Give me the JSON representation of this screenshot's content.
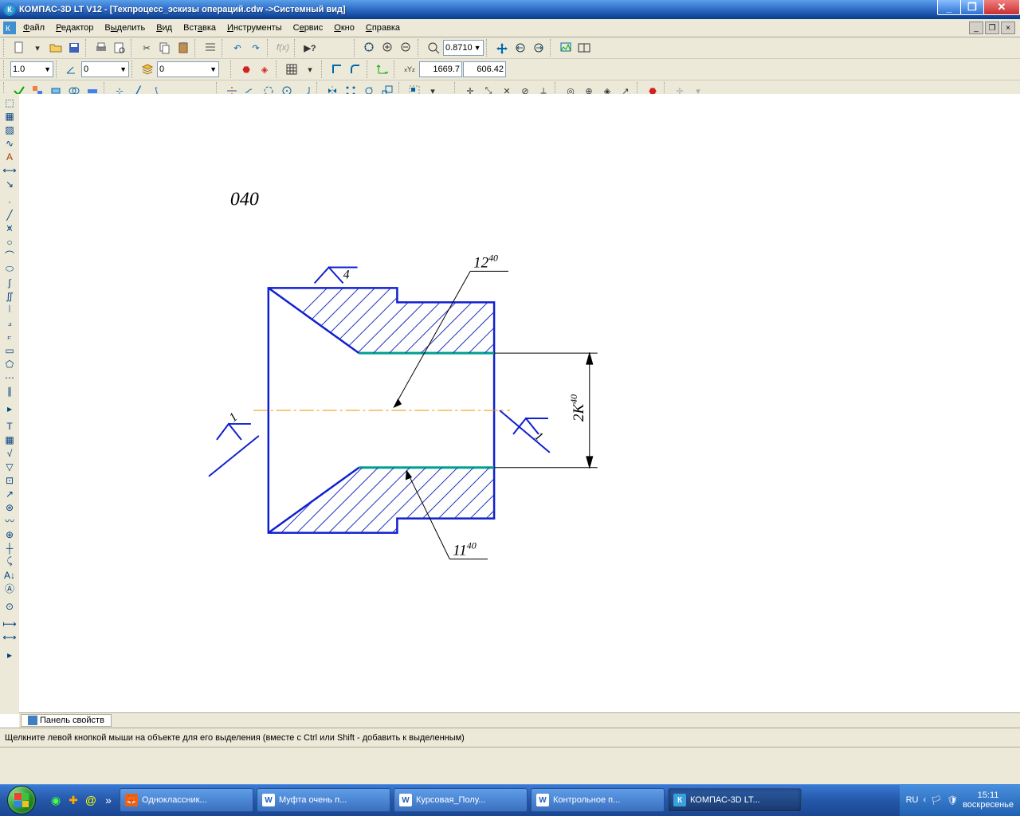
{
  "titlebar": {
    "app": "КОМПАС-3D LT V12",
    "doc": "[Техпроцесс_эскизы операций.cdw ->Системный вид]"
  },
  "menu": {
    "file": "Файл",
    "edit": "Редактор",
    "select": "Выделить",
    "view": "Вид",
    "insert": "Вставка",
    "tools": "Инструменты",
    "service": "Сервис",
    "window": "Окно",
    "help": "Справка"
  },
  "toolbar": {
    "zoom_val": "0.8710",
    "step": "1.0",
    "angle": "0",
    "layer": "0",
    "coord_x": "1669.7",
    "coord_y": "606.42"
  },
  "props": {
    "tab_label": "Панель свойств"
  },
  "status": {
    "hint": "Щелкните левой кнопкой мыши на объекте для его выделения (вместе с Ctrl или Shift - добавить к выделенным)"
  },
  "taskbar": {
    "items": [
      {
        "label": "Одноклассник..."
      },
      {
        "label": "Муфта очень п..."
      },
      {
        "label": "Курсовая_Полу..."
      },
      {
        "label": "Контрольное п..."
      },
      {
        "label": "КОМПАС-3D LT..."
      }
    ],
    "lang": "RU",
    "time": "15:11",
    "day": "воскресенье"
  },
  "drawing": {
    "op_number": "040",
    "dim_top": "12",
    "dim_top_sup": "40",
    "dim_bot": "11",
    "dim_bot_sup": "40",
    "dim_right": "2К",
    "dim_right_sup": "40",
    "surf_top": "4",
    "surf_left": "1",
    "surf_right": "1"
  }
}
